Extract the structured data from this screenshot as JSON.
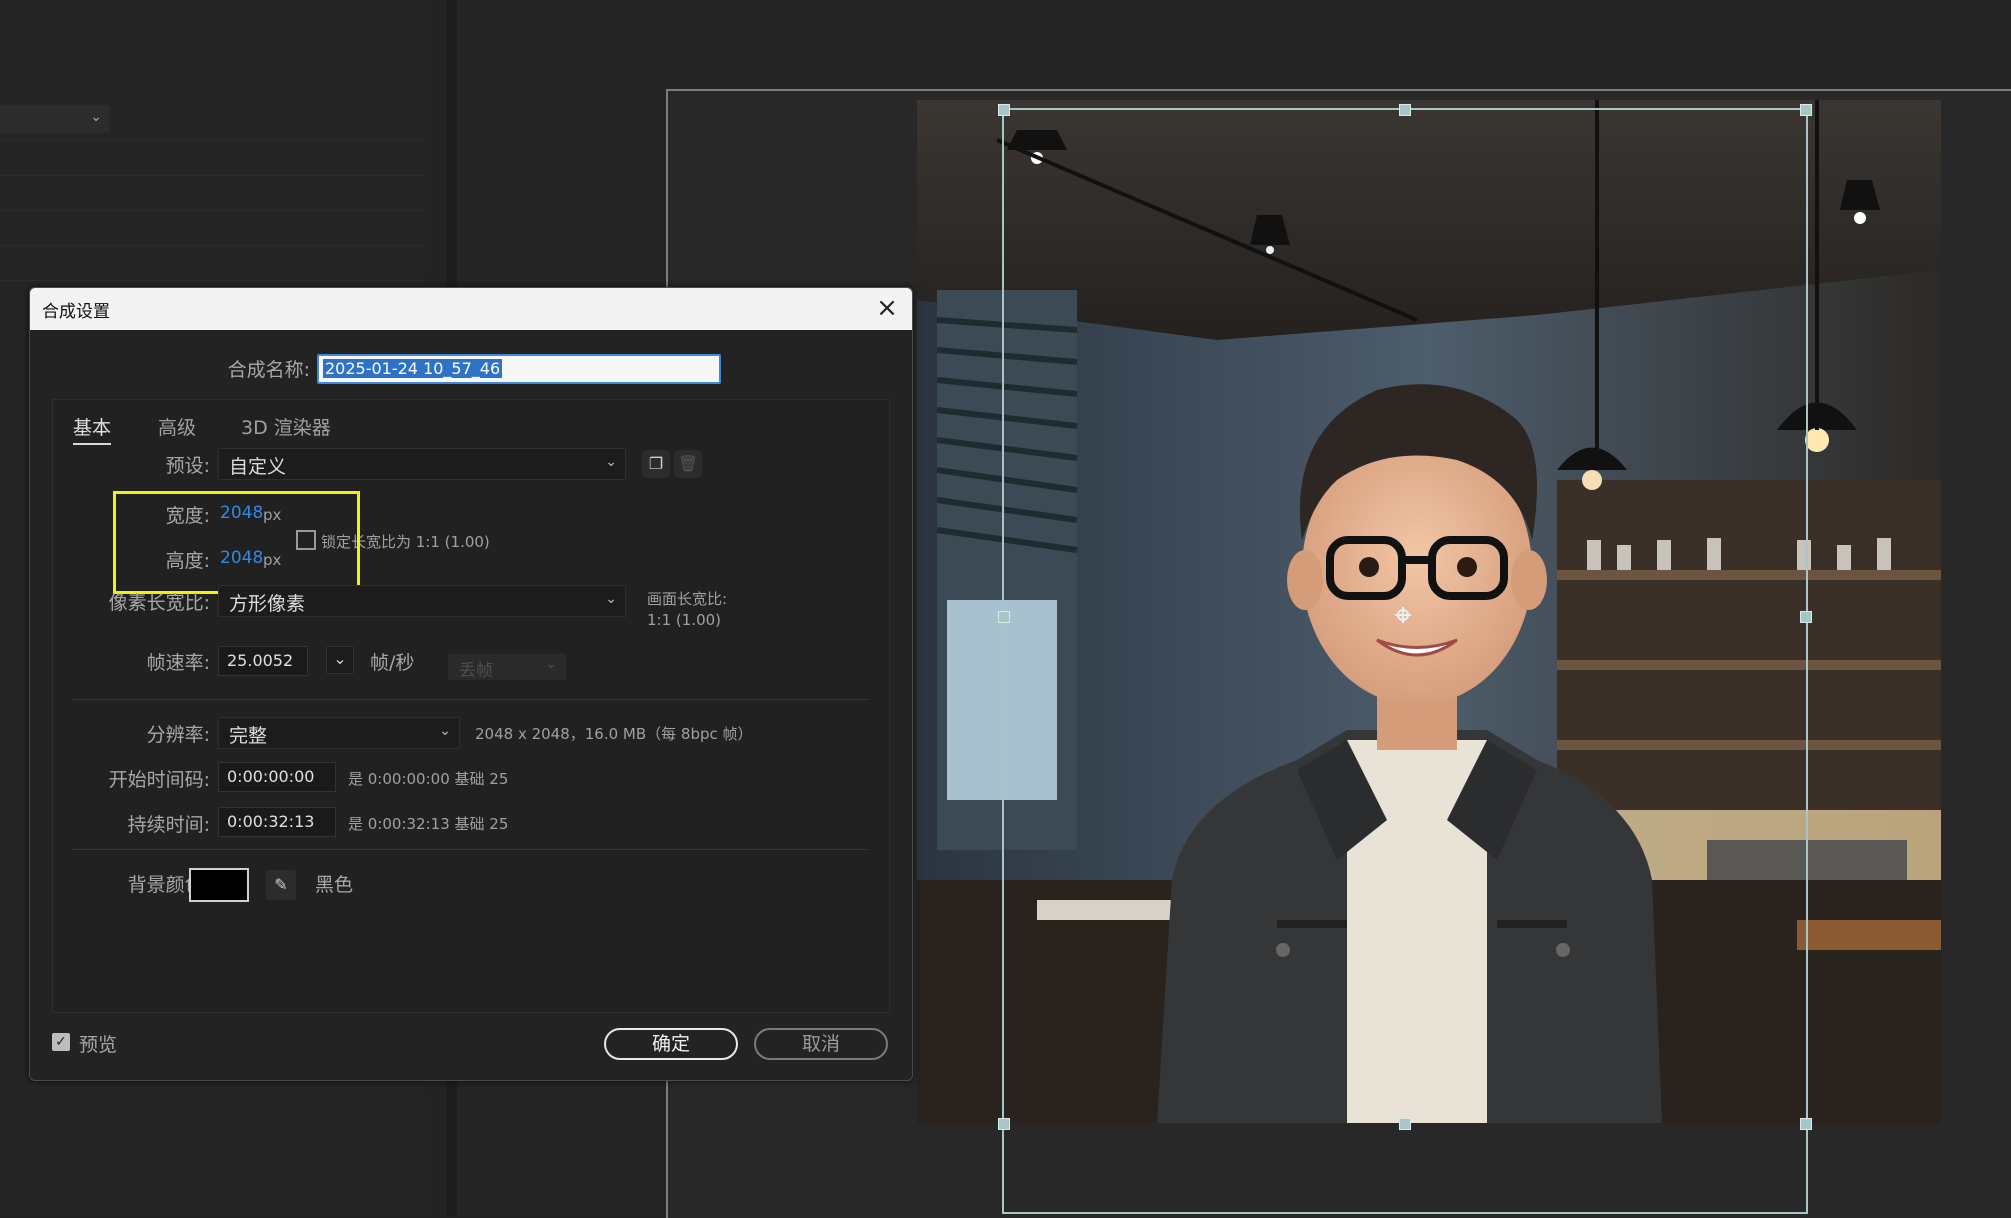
{
  "dialog": {
    "title": "合成设置",
    "name_label": "合成名称:",
    "name_value": "2025-01-24 10_57_46",
    "tabs": [
      {
        "label": "基本",
        "active": true
      },
      {
        "label": "高级",
        "active": false
      },
      {
        "label": "3D 渲染器",
        "active": false
      }
    ],
    "preset_label": "预设:",
    "preset_value": "自定义",
    "width_label": "宽度:",
    "width_value": "2048",
    "height_label": "高度:",
    "height_value": "2048",
    "px_unit": "px",
    "lock_aspect_label": "锁定长宽比为 1:1 (1.00)",
    "lock_aspect_checked": false,
    "pixel_aspect_label": "像素长宽比:",
    "pixel_aspect_value": "方形像素",
    "frame_aspect_label": "画面长宽比:",
    "frame_aspect_value": "1:1 (1.00)",
    "framerate_label": "帧速率:",
    "framerate_value": "25.0052",
    "fps_unit": "帧/秒",
    "drop_frame_value": "丢帧",
    "resolution_label": "分辨率:",
    "resolution_value": "完整",
    "resolution_info": "2048 x 2048，16.0 MB（每 8bpc 帧）",
    "start_timecode_label": "开始时间码:",
    "start_timecode_value": "0:00:00:00",
    "start_timecode_info": "是 0:00:00:00  基础 25",
    "duration_label": "持续时间:",
    "duration_value": "0:00:32:13",
    "duration_info": "是 0:00:32:13  基础 25",
    "bg_color_label": "背景颜色:",
    "bg_color_name": "黑色",
    "bg_color": "#000000",
    "preview_label": "预览",
    "preview_checked": true,
    "ok_label": "确定",
    "cancel_label": "取消"
  },
  "icons": {
    "close": "close-icon",
    "new_preset": "new-preset-icon",
    "delete_preset": "trash-icon",
    "eyedropper": "eyedropper-icon"
  },
  "colors": {
    "highlight_box": "#f2f20a",
    "selection_blue": "#2f73c8",
    "value_blue": "#2e8ae6",
    "bounding_box": "#a8c6c7"
  }
}
